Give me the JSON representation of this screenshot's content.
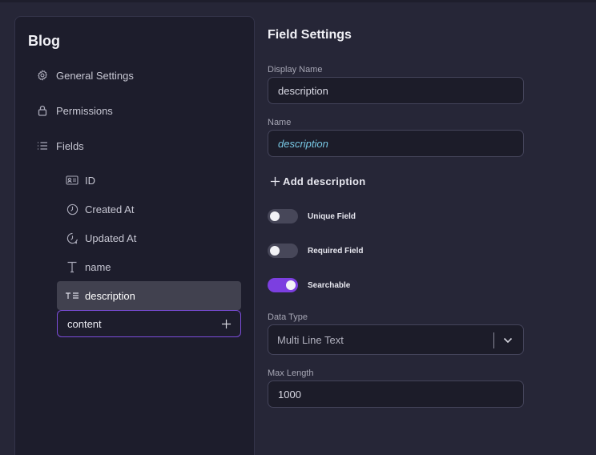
{
  "sidebar": {
    "title": "Blog",
    "nav": [
      {
        "label": "General Settings",
        "icon": "gear-icon"
      },
      {
        "label": "Permissions",
        "icon": "lock-icon"
      },
      {
        "label": "Fields",
        "icon": "list-icon"
      }
    ],
    "fields": [
      {
        "label": "ID",
        "icon": "id-card-icon"
      },
      {
        "label": "Created At",
        "icon": "clock-icon"
      },
      {
        "label": "Updated At",
        "icon": "clock-refresh-icon"
      },
      {
        "label": "name",
        "icon": "text-icon"
      },
      {
        "label": "description",
        "icon": "text-lines-icon",
        "active": true
      }
    ],
    "new_field_value": "content"
  },
  "main": {
    "title": "Field Settings",
    "display_name": {
      "label": "Display Name",
      "value": "description"
    },
    "name": {
      "label": "Name",
      "value": "description"
    },
    "add_description": "Add description",
    "toggles": [
      {
        "label": "Unique Field",
        "on": false
      },
      {
        "label": "Required Field",
        "on": false
      },
      {
        "label": "Searchable",
        "on": true
      }
    ],
    "data_type": {
      "label": "Data Type",
      "value": "Multi Line Text"
    },
    "max_length": {
      "label": "Max Length",
      "value": "1000"
    }
  },
  "colors": {
    "accent": "#7c3fe0",
    "accent_border": "#7c4ddb",
    "name_text": "#78c8e4"
  }
}
